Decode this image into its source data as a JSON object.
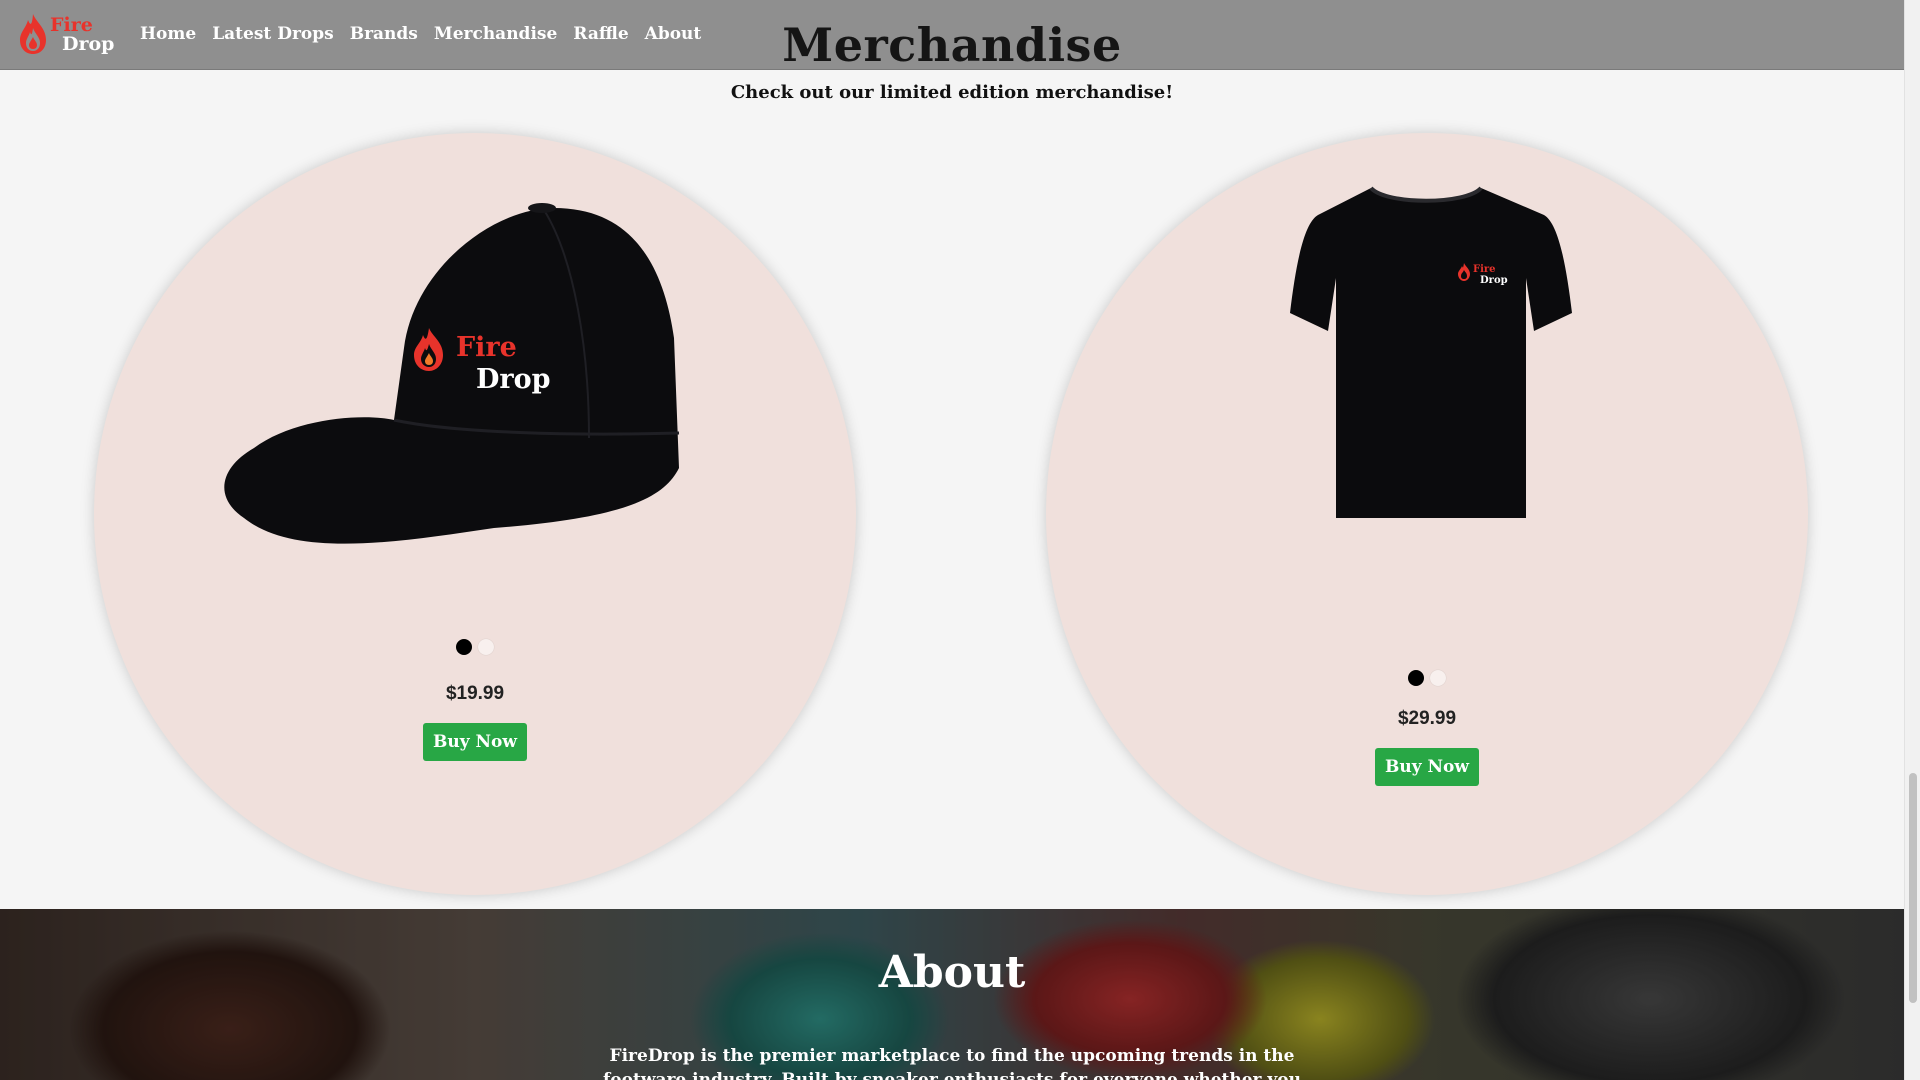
{
  "brand": {
    "word1": "Fire",
    "word2": "Drop",
    "icon": "flame-icon"
  },
  "nav": {
    "items": [
      "Home",
      "Latest Drops",
      "Brands",
      "Merchandise",
      "Raffle",
      "About"
    ]
  },
  "merch": {
    "title": "Merchandise",
    "subtitle": "Check out our limited edition merchandise!",
    "products": [
      {
        "name": "cap",
        "image_text": {
          "w1": "Fire",
          "w2": "Drop"
        },
        "colors": [
          "#000000",
          "#f8f0ee"
        ],
        "price": "$19.99",
        "button": "Buy Now"
      },
      {
        "name": "t-shirt",
        "image_text": {
          "w1": "Fire",
          "w2": "Drop"
        },
        "colors": [
          "#000000",
          "#f8f0ee"
        ],
        "price": "$29.99",
        "button": "Buy Now"
      }
    ]
  },
  "about": {
    "title": "About",
    "text": "FireDrop is the premier marketplace to find the upcoming trends in the footware industry. Built by sneaker enthusiasts for everyone whether you are a sneaker head"
  },
  "colors": {
    "nav_bg": "#8f8f8f",
    "brand_red": "#e8332b",
    "buy_green": "#28a745",
    "card_bg": "#f0e0dc"
  }
}
